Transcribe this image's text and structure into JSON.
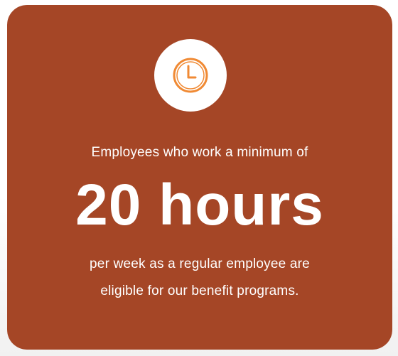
{
  "colors": {
    "card_background": "#A54626",
    "icon_accent": "#F08A34",
    "icon_circle": "#FFFFFF",
    "text": "#FFFFFF"
  },
  "icon": {
    "name": "clock-icon"
  },
  "card": {
    "lead_text": "Employees who work a minimum of",
    "headline": "20 hours",
    "detail_lines": [
      "per week as a regular employee are",
      "eligible for our benefit programs."
    ]
  }
}
